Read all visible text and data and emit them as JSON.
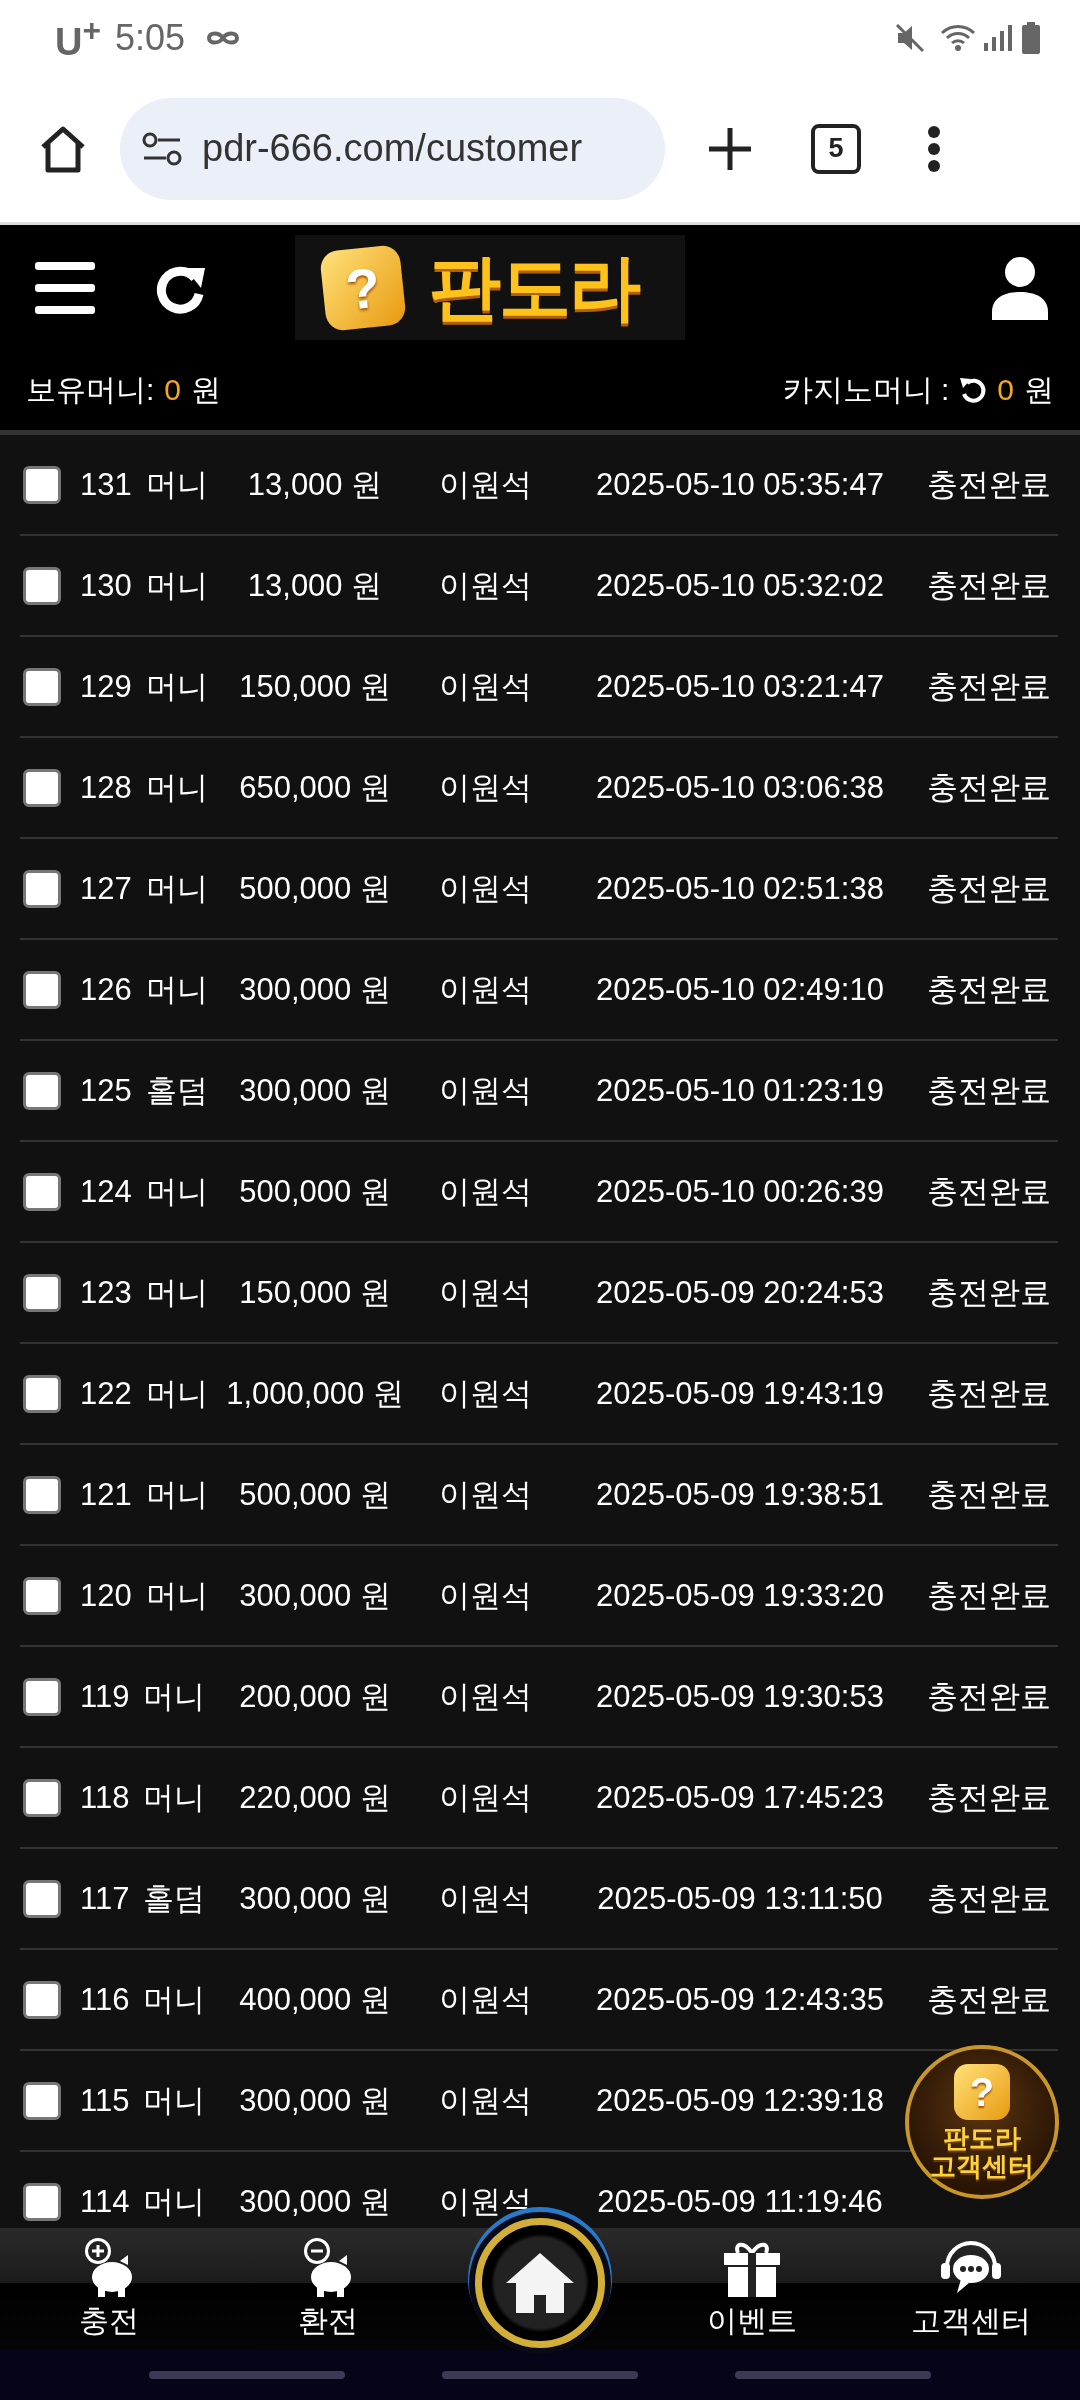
{
  "status_bar": {
    "carrier": "U$^{+}$",
    "time": "5:05"
  },
  "browser": {
    "url": "pdr-666.com/customer",
    "tab_count": "5"
  },
  "header": {
    "logo_mark": "?",
    "logo": "판도라",
    "balance_label": "보유머니:",
    "balance_value": "0",
    "balance_unit": "원",
    "casino_label": "카지노머니 :",
    "casino_value": "0",
    "casino_unit": "원"
  },
  "rows": [
    {
      "checked": false,
      "id": "131",
      "type": "머니",
      "amount": "13,000 원",
      "name": "이원석",
      "datetime": "2025-05-10 05:35:47",
      "status": "충전완료"
    },
    {
      "checked": false,
      "id": "130",
      "type": "머니",
      "amount": "13,000 원",
      "name": "이원석",
      "datetime": "2025-05-10 05:32:02",
      "status": "충전완료"
    },
    {
      "checked": false,
      "id": "129",
      "type": "머니",
      "amount": "150,000 원",
      "name": "이원석",
      "datetime": "2025-05-10 03:21:47",
      "status": "충전완료"
    },
    {
      "checked": false,
      "id": "128",
      "type": "머니",
      "amount": "650,000 원",
      "name": "이원석",
      "datetime": "2025-05-10 03:06:38",
      "status": "충전완료"
    },
    {
      "checked": false,
      "id": "127",
      "type": "머니",
      "amount": "500,000 원",
      "name": "이원석",
      "datetime": "2025-05-10 02:51:38",
      "status": "충전완료"
    },
    {
      "checked": false,
      "id": "126",
      "type": "머니",
      "amount": "300,000 원",
      "name": "이원석",
      "datetime": "2025-05-10 02:49:10",
      "status": "충전완료"
    },
    {
      "checked": false,
      "id": "125",
      "type": "홀덤",
      "amount": "300,000 원",
      "name": "이원석",
      "datetime": "2025-05-10 01:23:19",
      "status": "충전완료"
    },
    {
      "checked": false,
      "id": "124",
      "type": "머니",
      "amount": "500,000 원",
      "name": "이원석",
      "datetime": "2025-05-10 00:26:39",
      "status": "충전완료"
    },
    {
      "checked": false,
      "id": "123",
      "type": "머니",
      "amount": "150,000 원",
      "name": "이원석",
      "datetime": "2025-05-09 20:24:53",
      "status": "충전완료"
    },
    {
      "checked": false,
      "id": "122",
      "type": "머니",
      "amount": "1,000,000 원",
      "name": "이원석",
      "datetime": "2025-05-09 19:43:19",
      "status": "충전완료"
    },
    {
      "checked": false,
      "id": "121",
      "type": "머니",
      "amount": "500,000 원",
      "name": "이원석",
      "datetime": "2025-05-09 19:38:51",
      "status": "충전완료"
    },
    {
      "checked": false,
      "id": "120",
      "type": "머니",
      "amount": "300,000 원",
      "name": "이원석",
      "datetime": "2025-05-09 19:33:20",
      "status": "충전완료"
    },
    {
      "checked": false,
      "id": "119",
      "type": "머니",
      "amount": "200,000 원",
      "name": "이원석",
      "datetime": "2025-05-09 19:30:53",
      "status": "충전완료"
    },
    {
      "checked": false,
      "id": "118",
      "type": "머니",
      "amount": "220,000 원",
      "name": "이원석",
      "datetime": "2025-05-09 17:45:23",
      "status": "충전완료"
    },
    {
      "checked": false,
      "id": "117",
      "type": "홀덤",
      "amount": "300,000 원",
      "name": "이원석",
      "datetime": "2025-05-09 13:11:50",
      "status": "충전완료"
    },
    {
      "checked": false,
      "id": "116",
      "type": "머니",
      "amount": "400,000 원",
      "name": "이원석",
      "datetime": "2025-05-09 12:43:35",
      "status": "충전완료"
    },
    {
      "checked": false,
      "id": "115",
      "type": "머니",
      "amount": "300,000 원",
      "name": "이원석",
      "datetime": "2025-05-09 12:39:18"
    },
    {
      "checked": false,
      "id": "114",
      "type": "머니",
      "amount": "300,000 원",
      "name": "이원석",
      "datetime": "2025-05-09 11:19:46"
    }
  ],
  "help_badge": {
    "mark": "?",
    "title": "판도라",
    "subtitle": "고객센터"
  },
  "bottom_nav": [
    {
      "kind": "deposit",
      "label": "충전"
    },
    {
      "kind": "withdraw",
      "label": "환전"
    },
    {
      "kind": "home"
    },
    {
      "kind": "event",
      "label": "이벤트"
    },
    {
      "kind": "support",
      "label": "고객센터"
    }
  ]
}
